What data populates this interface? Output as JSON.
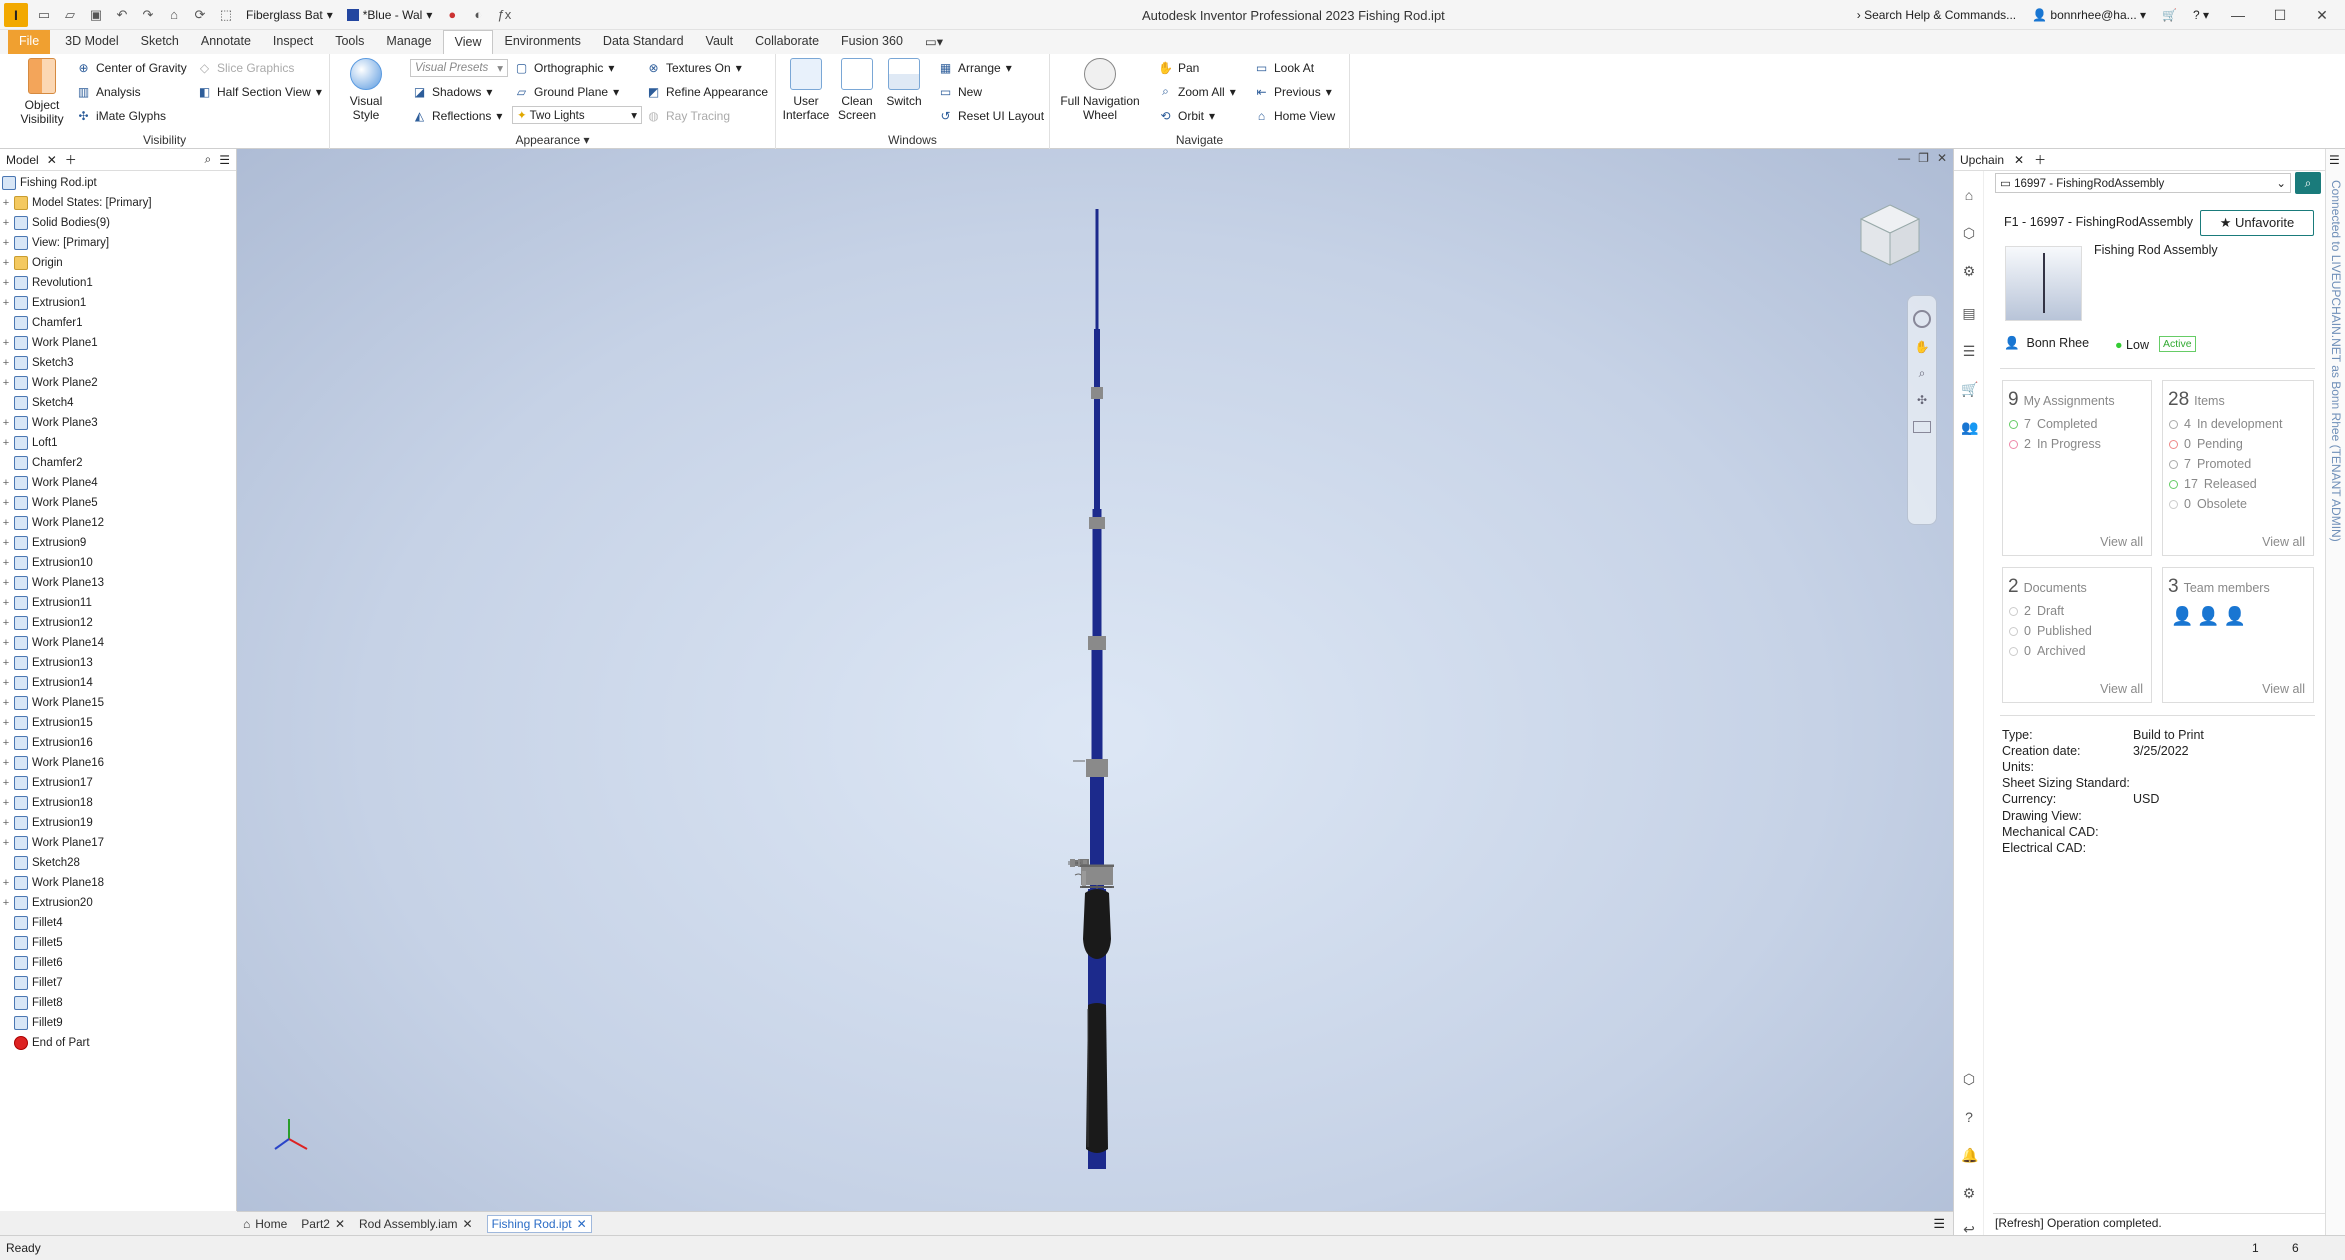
{
  "titlebar": {
    "logo": "I",
    "material": "Fiberglass Bat",
    "appearance": "*Blue - Wal",
    "title": "Autodesk Inventor Professional 2023   Fishing Rod.ipt",
    "search": "Search Help & Commands...",
    "user": "bonnrhee@ha..."
  },
  "menu": [
    "File",
    "3D Model",
    "Sketch",
    "Annotate",
    "Inspect",
    "Tools",
    "Manage",
    "View",
    "Environments",
    "Data Standard",
    "Vault",
    "Collaborate",
    "Fusion 360"
  ],
  "ribbon": {
    "visibility": {
      "object_visibility": "Object Visibility",
      "center_gravity": "Center of Gravity",
      "slice_graphics": "Slice Graphics",
      "analysis": "Analysis",
      "half_section": "Half Section View",
      "imate": "iMate Glyphs",
      "title": "Visibility"
    },
    "appearance": {
      "visual_style": "Visual Style",
      "visual_presets": "Visual Presets",
      "orthographic": "Orthographic",
      "textures": "Textures On",
      "shadows": "Shadows",
      "ground_plane": "Ground Plane",
      "refine": "Refine Appearance",
      "reflections": "Reflections",
      "two_lights": "Two Lights",
      "ray_tracing": "Ray Tracing",
      "title": "Appearance"
    },
    "windows": {
      "user_interface": "User Interface",
      "clean_screen": "Clean Screen",
      "switch": "Switch",
      "arrange": "Arrange",
      "new": "New",
      "reset": "Reset UI Layout",
      "title": "Windows"
    },
    "navigate": {
      "full_nav": "Full Navigation Wheel",
      "pan": "Pan",
      "zoom_all": "Zoom All",
      "orbit": "Orbit",
      "look_at": "Look At",
      "previous": "Previous",
      "home_view": "Home View",
      "title": "Navigate"
    }
  },
  "model": {
    "tab": "Model",
    "root": "Fishing Rod.ipt",
    "items": [
      "Model States: [Primary]",
      "Solid Bodies(9)",
      "View: [Primary]",
      "Origin",
      "Revolution1",
      "Extrusion1",
      "Chamfer1",
      "Work Plane1",
      "Sketch3",
      "Work Plane2",
      "Sketch4",
      "Work Plane3",
      "Loft1",
      "Chamfer2",
      "Work Plane4",
      "Work Plane5",
      "Work Plane12",
      "Extrusion9",
      "Extrusion10",
      "Work Plane13",
      "Extrusion11",
      "Extrusion12",
      "Work Plane14",
      "Extrusion13",
      "Extrusion14",
      "Work Plane15",
      "Extrusion15",
      "Extrusion16",
      "Work Plane16",
      "Extrusion17",
      "Extrusion18",
      "Extrusion19",
      "Work Plane17",
      "Sketch28",
      "Work Plane18",
      "Extrusion20",
      "Fillet4",
      "Fillet5",
      "Fillet6",
      "Fillet7",
      "Fillet8",
      "Fillet9",
      "End of Part"
    ]
  },
  "doctabs": [
    "Home",
    "Part2",
    "Rod Assembly.iam",
    "Fishing Rod.ipt"
  ],
  "upchain": {
    "tab": "Upchain",
    "selector": "16997 - FishingRodAssembly",
    "item_title": "F1 - 16997 - FishingRodAssembly",
    "unfavorite": "Unfavorite",
    "desc": "Fishing Rod Assembly",
    "owner": "Bonn Rhee",
    "priority": "Low",
    "state": "Active",
    "cards": {
      "assignments": {
        "count": "9",
        "label": "My Assignments",
        "rows": [
          [
            "7",
            "Completed"
          ],
          [
            "2",
            "In Progress"
          ]
        ]
      },
      "items": {
        "count": "28",
        "label": "Items",
        "rows": [
          [
            "4",
            "In development"
          ],
          [
            "0",
            "Pending"
          ],
          [
            "7",
            "Promoted"
          ],
          [
            "17",
            "Released"
          ],
          [
            "0",
            "Obsolete"
          ]
        ]
      },
      "documents": {
        "count": "2",
        "label": "Documents",
        "rows": [
          [
            "2",
            "Draft"
          ],
          [
            "0",
            "Published"
          ],
          [
            "0",
            "Archived"
          ]
        ]
      },
      "team": {
        "count": "3",
        "label": "Team members"
      }
    },
    "view_all": "View all",
    "props": [
      [
        "Type:",
        "Build to Print"
      ],
      [
        "Creation date:",
        "3/25/2022"
      ],
      [
        "Units:",
        ""
      ],
      [
        "Sheet Sizing Standard:",
        ""
      ],
      [
        "Currency:",
        "USD"
      ],
      [
        "Drawing View:",
        ""
      ],
      [
        "Mechanical CAD:",
        ""
      ],
      [
        "Electrical CAD:",
        ""
      ]
    ],
    "status_msg": "[Refresh] Operation completed.",
    "vertical": "Connected to LIVEUPCHAIN.NET as Bonn Rhee (TENANT ADMIN)"
  },
  "status": {
    "text": "Ready",
    "n1": "1",
    "n2": "6"
  },
  "colors": {
    "accent": "#f0a030",
    "rod": "#1c2a8c",
    "handle": "#1a1a1a",
    "viewport": "#c6d2e6"
  }
}
